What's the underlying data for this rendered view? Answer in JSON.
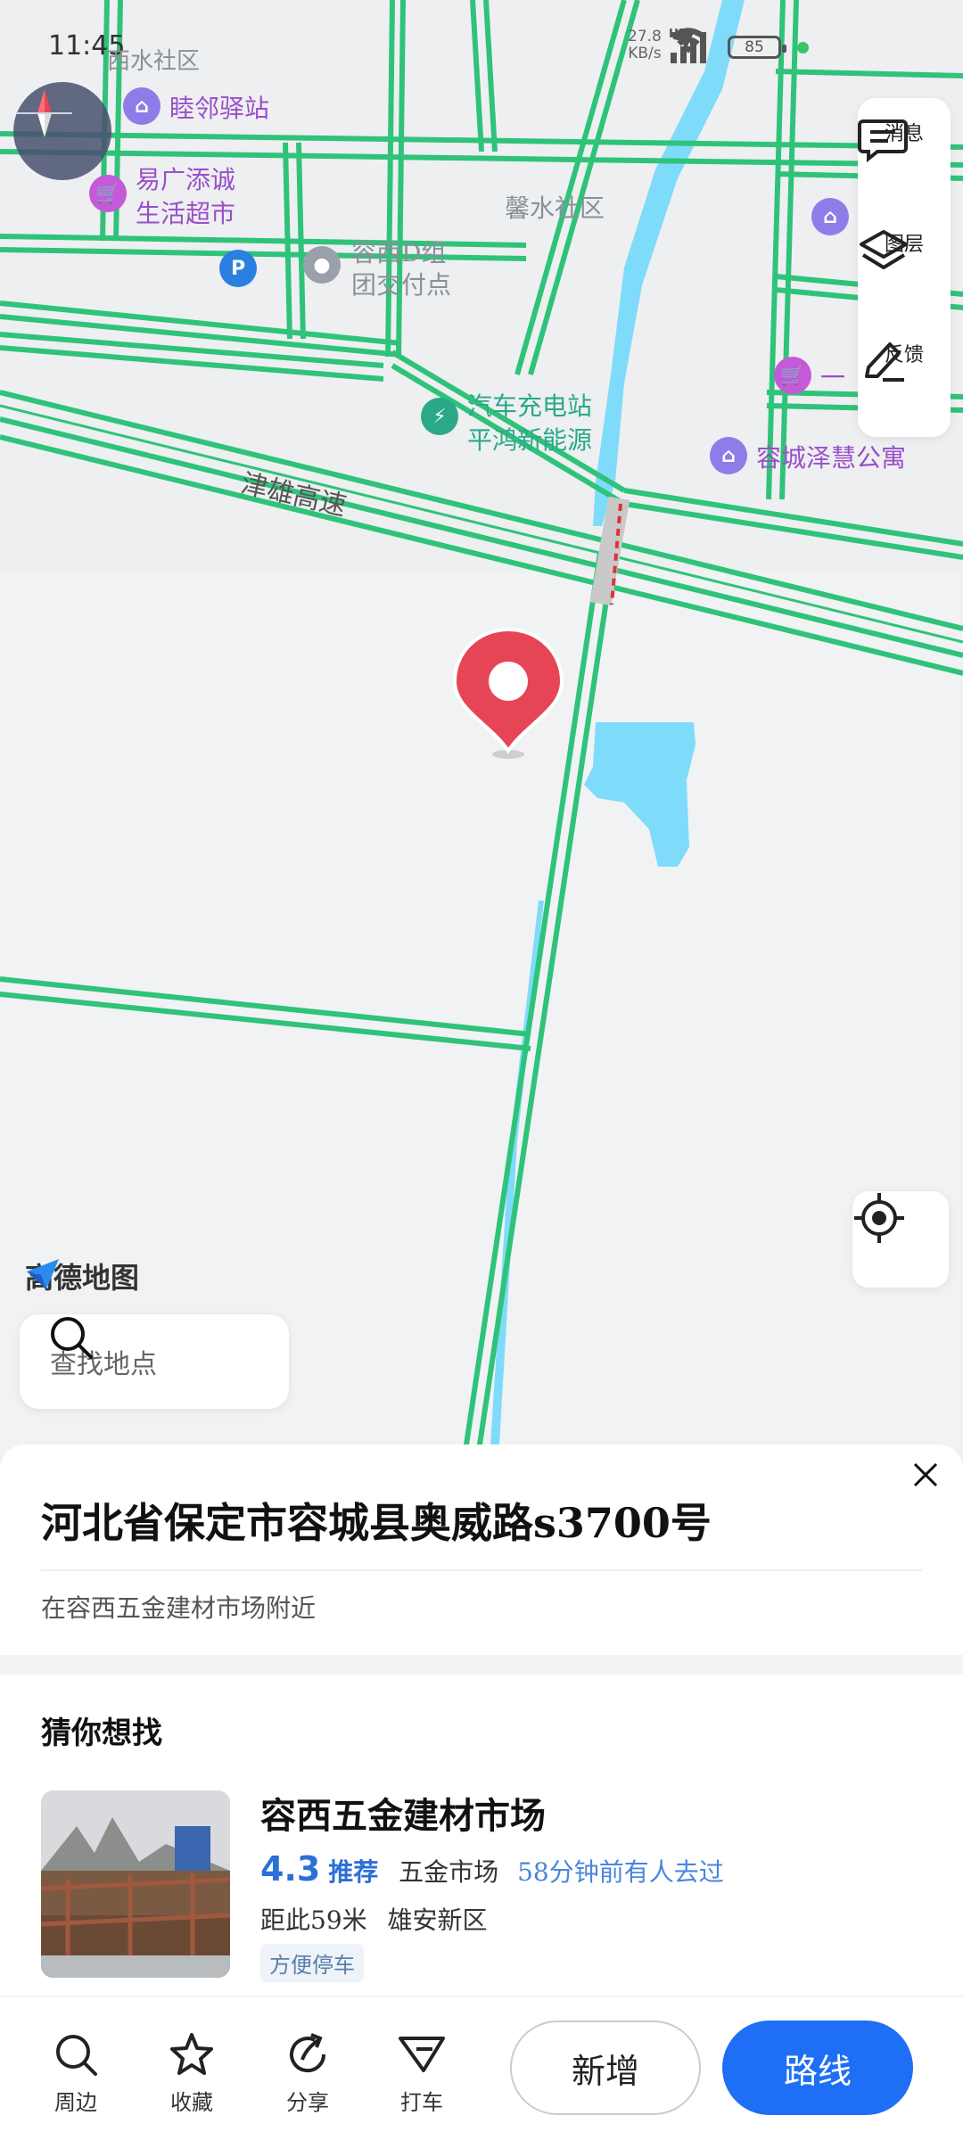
{
  "status_bar": {
    "time": "11:45",
    "speed_value": "27.8",
    "speed_unit": "KB/s",
    "network": "HD",
    "battery": "85"
  },
  "map": {
    "poi_labels": {
      "zone_top_left": "西水社区",
      "hostel": "睦邻驿站",
      "market": "易广添诚生活超市",
      "market_line1": "易广添诚",
      "market_line2": "生活超市",
      "community": "馨水社区",
      "pickup_line1": "容西D组",
      "pickup_line2": "团交付点",
      "charging_line1": "汽车充电站",
      "charging_line2": "平鸿新能源",
      "shop_right": "一",
      "apartment": "容城泽慧公寓",
      "highway": "津雄高速"
    },
    "icons": {
      "compass": "compass-icon",
      "message": "message-icon",
      "layers": "layers-icon",
      "feedback": "feedback-icon",
      "locate": "locate-icon",
      "search": "search-icon"
    },
    "colors": {
      "road": "#2fc37a",
      "water": "#7fdbfa",
      "pin": "#e64556",
      "accent": "#1e6ff5"
    }
  },
  "right_panel": {
    "message": "消息",
    "layers": "图层",
    "feedback": "反馈"
  },
  "logo": {
    "text": "高德地图"
  },
  "search": {
    "placeholder": "查找地点"
  },
  "place": {
    "address": "河北省保定市容城县奥威路s3700号",
    "nearby": "在容西五金建材市场附近"
  },
  "suggest": {
    "title": "猜你想找",
    "item": {
      "name": "容西五金建材市场",
      "rating": "4.3",
      "recommend": "推荐",
      "category": "五金市场",
      "visited": "58分钟前有人去过",
      "distance": "距此59米",
      "district": "雄安新区",
      "tag": "方便停车"
    }
  },
  "bottom_bar": {
    "nearby": "周边",
    "favorite": "收藏",
    "share": "分享",
    "taxi": "打车",
    "add": "新增",
    "route": "路线"
  }
}
